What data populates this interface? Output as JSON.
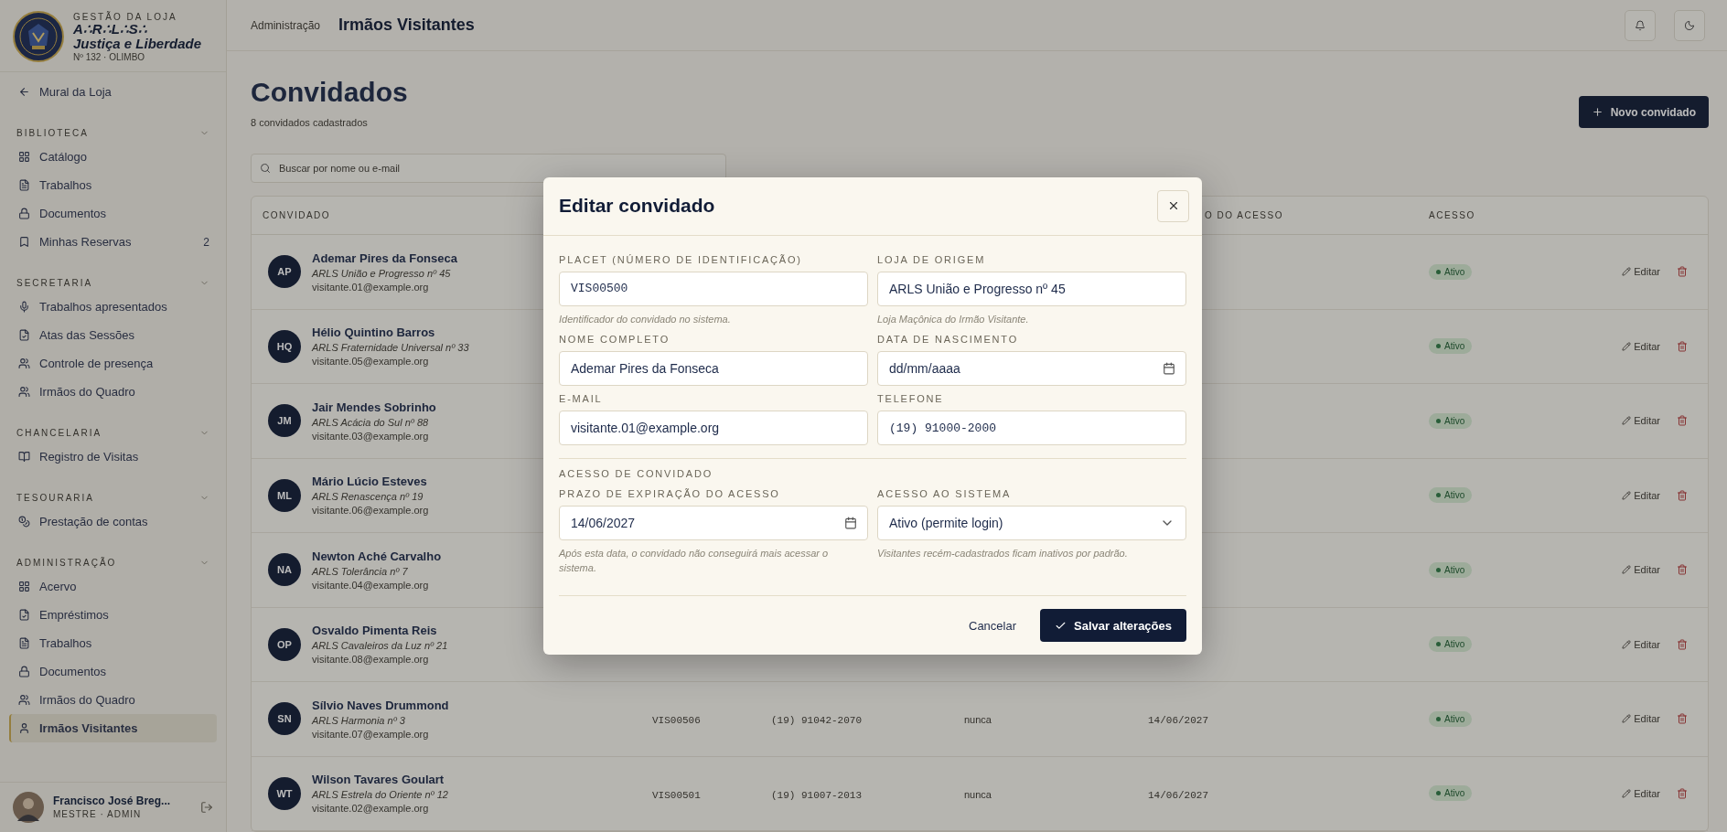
{
  "sidebar": {
    "brand": {
      "eyebrow": "GESTÃO DA LOJA",
      "name": "A∴R∴L∴S∴",
      "subtitle": "Justiça e Liberdade",
      "number": "Nº 132 · OLIMBO"
    },
    "back_link": {
      "label": "Mural da Loja"
    },
    "sections": [
      {
        "title": "BIBLIOTECA",
        "items": [
          {
            "label": "Catálogo",
            "selected": false
          },
          {
            "label": "Trabalhos",
            "selected": false
          },
          {
            "label": "Documentos",
            "selected": false
          },
          {
            "label": "Minhas Reservas",
            "badge": "2",
            "selected": false
          }
        ]
      },
      {
        "title": "SECRETARIA",
        "items": [
          {
            "label": "Trabalhos apresentados",
            "selected": false
          },
          {
            "label": "Atas das Sessões",
            "selected": false
          },
          {
            "label": "Controle de presença",
            "selected": false
          },
          {
            "label": "Irmãos do Quadro",
            "selected": false
          }
        ]
      },
      {
        "title": "CHANCELARIA",
        "items": [
          {
            "label": "Registro de Visitas",
            "selected": false
          }
        ]
      },
      {
        "title": "TESOURARIA",
        "items": [
          {
            "label": "Prestação de contas",
            "selected": false
          }
        ]
      },
      {
        "title": "ADMINISTRAÇÃO",
        "items": [
          {
            "label": "Acervo",
            "selected": false
          },
          {
            "label": "Empréstimos",
            "selected": false
          },
          {
            "label": "Trabalhos",
            "selected": false
          },
          {
            "label": "Documentos",
            "selected": false
          },
          {
            "label": "Irmãos do Quadro",
            "selected": false
          },
          {
            "label": "Irmãos Visitantes",
            "selected": true
          }
        ]
      }
    ],
    "user": {
      "name": "Francisco José Breg...",
      "role": "MESTRE · ADMIN"
    }
  },
  "header": {
    "breadcrumb": "Administração",
    "title": "Irmãos Visitantes"
  },
  "page": {
    "title": "Convidados",
    "subtitle": "8 convidados cadastrados",
    "new_button": "Novo convidado",
    "search_placeholder": "Buscar por nome ou e-mail"
  },
  "table": {
    "columns": [
      {
        "label": "CONVIDADO"
      },
      {
        "label": "O DO ACESSO"
      },
      {
        "label": "ACESSO"
      }
    ],
    "rows": [
      {
        "initials": "AP",
        "name": "Ademar Pires da Fonseca",
        "lodge": "ARLS União e Progresso nº 45",
        "email": "visitante.01@example.org",
        "status": "Ativo",
        "edit": "Editar"
      },
      {
        "initials": "HQ",
        "name": "Hélio Quintino Barros",
        "lodge": "ARLS Fraternidade Universal nº 33",
        "email": "visitante.05@example.org",
        "status": "Ativo",
        "edit": "Editar"
      },
      {
        "initials": "JM",
        "name": "Jair Mendes Sobrinho",
        "lodge": "ARLS Acácia do Sul nº 88",
        "email": "visitante.03@example.org",
        "status": "Ativo",
        "edit": "Editar"
      },
      {
        "initials": "ML",
        "name": "Mário Lúcio Esteves",
        "lodge": "ARLS Renascença nº 19",
        "email": "visitante.06@example.org",
        "status": "Ativo",
        "edit": "Editar"
      },
      {
        "initials": "NA",
        "name": "Newton Aché Carvalho",
        "lodge": "ARLS Tolerância nº 7",
        "email": "visitante.04@example.org",
        "status": "Ativo",
        "edit": "Editar"
      },
      {
        "initials": "OP",
        "name": "Osvaldo Pimenta Reis",
        "lodge": "ARLS Cavaleiros da Luz nº 21",
        "email": "visitante.08@example.org",
        "status": "Ativo",
        "edit": "Editar"
      },
      {
        "initials": "SN",
        "name": "Sílvio Naves Drummond",
        "lodge": "ARLS Harmonia nº 3",
        "email": "visitante.07@example.org",
        "placet": "VIS00506",
        "phone": "(19) 91042-2070",
        "last_access": "nunca",
        "expiry": "14/06/2027",
        "status": "Ativo",
        "edit": "Editar"
      },
      {
        "initials": "WT",
        "name": "Wilson Tavares Goulart",
        "lodge": "ARLS Estrela do Oriente nº 12",
        "email": "visitante.02@example.org",
        "placet": "VIS00501",
        "phone": "(19) 91007-2013",
        "last_access": "nunca",
        "expiry": "14/06/2027",
        "status": "Ativo",
        "edit": "Editar"
      }
    ]
  },
  "modal": {
    "title": "Editar convidado",
    "groups": [
      {
        "fields": [
          {
            "kind": "mono",
            "label": "PLACET (NÚMERO DE IDENTIFICAÇÃO)",
            "value": "VIS00500",
            "hint": "Identificador do convidado no sistema."
          },
          {
            "kind": "text",
            "label": "LOJA DE ORIGEM",
            "value": "ARLS União e Progresso nº 45",
            "hint": "Loja Maçônica do Irmão Visitante."
          },
          {
            "kind": "text",
            "label": "NOME COMPLETO",
            "value": "Ademar Pires da Fonseca"
          },
          {
            "kind": "date",
            "label": "DATA DE NASCIMENTO",
            "placeholder": "dd/mm/aaaa"
          },
          {
            "kind": "text",
            "label": "E-MAIL",
            "value": "visitante.01@example.org"
          },
          {
            "kind": "mono",
            "label": "TELEFONE",
            "value": "(19) 91000-2000"
          }
        ]
      },
      {
        "title": "ACESSO DE CONVIDADO",
        "fields": [
          {
            "kind": "date",
            "label": "PRAZO DE EXPIRAÇÃO DO ACESSO",
            "value": "14/06/2027",
            "hint": "Após esta data, o convidado não conseguirá mais acessar o sistema."
          },
          {
            "kind": "select",
            "label": "ACESSO AO SISTEMA",
            "value": "Ativo (permite login)",
            "hint": "Visitantes recém-cadastrados ficam inativos por padrão."
          }
        ]
      }
    ],
    "cancel": "Cancelar",
    "save": "Salvar alterações"
  }
}
